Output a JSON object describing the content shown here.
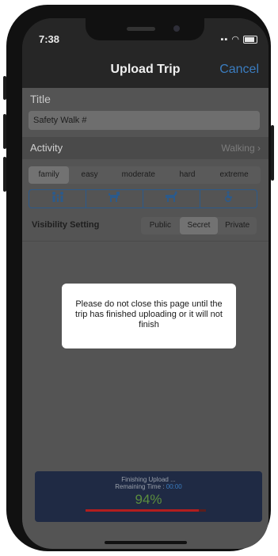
{
  "status": {
    "time": "7:38"
  },
  "nav": {
    "title": "Upload Trip",
    "cancel": "Cancel"
  },
  "form": {
    "title_label": "Title",
    "title_value": "Safety Walk #",
    "activity_label": "Activity",
    "activity_value": "Walking",
    "difficulty": [
      "family",
      "easy",
      "moderate",
      "hard",
      "extreme"
    ],
    "difficulty_selected": "family",
    "accessibility_icons": [
      "family-icon",
      "dog-icon",
      "horse-icon",
      "wheelchair-icon"
    ],
    "visibility_label": "Visibility Setting",
    "visibility": [
      "Public",
      "Secret",
      "Private"
    ],
    "visibility_selected": "Secret"
  },
  "dialog": {
    "message": "Please do not close this page until the trip has finished uploading or it will not finish"
  },
  "upload": {
    "status": "Finishing Upload ...",
    "remaining_label": "Remaining Time :",
    "remaining_value": "00:00",
    "percent_text": "94%",
    "progress": 0.94
  },
  "colors": {
    "accent": "#3b7dc0",
    "progress": "#b21e1e",
    "percent": "#5b8e3e"
  }
}
